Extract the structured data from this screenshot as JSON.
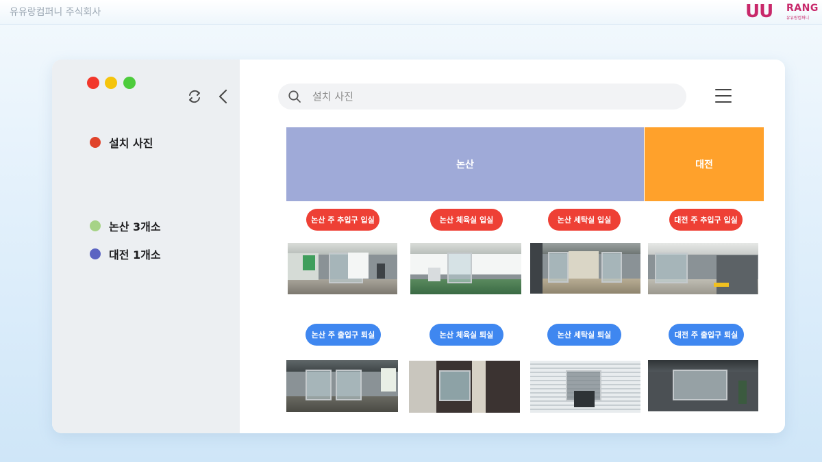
{
  "company_name": "유유랑컴퍼니 주식회사",
  "logo": {
    "mark": "UU",
    "name": "RANG",
    "sub": "유유랑컴퍼니"
  },
  "colors": {
    "accent_red": "#ee4035",
    "accent_blue": "#3f87f0",
    "region_nonsan": "#9faad8",
    "region_daejeon": "#ffa12b",
    "legend_install": "#e0432b",
    "legend_nonsan": "#a6d386",
    "legend_daejeon": "#5b64c2"
  },
  "sidebar": {
    "items": [
      {
        "label": "설치 사진",
        "color": "#e0432b"
      },
      {
        "label": "논산 3개소",
        "color": "#a6d386"
      },
      {
        "label": "대전 1개소",
        "color": "#5b64c2"
      }
    ]
  },
  "search": {
    "placeholder": "설치 사진",
    "value": ""
  },
  "regions": [
    {
      "label": "논산"
    },
    {
      "label": "대전"
    }
  ],
  "entrances": [
    {
      "label": "논산 주 추입구 입실"
    },
    {
      "label": "논산 체육실 입실"
    },
    {
      "label": "논산 세탁실 입실"
    },
    {
      "label": "대전 주 추입구 입실"
    }
  ],
  "exits": [
    {
      "label": "논산 주 출입구 퇴실"
    },
    {
      "label": "논산 체육실 퇴실"
    },
    {
      "label": "논산 세탁실 퇴실"
    },
    {
      "label": "대전 주 출입구 퇴실"
    }
  ]
}
